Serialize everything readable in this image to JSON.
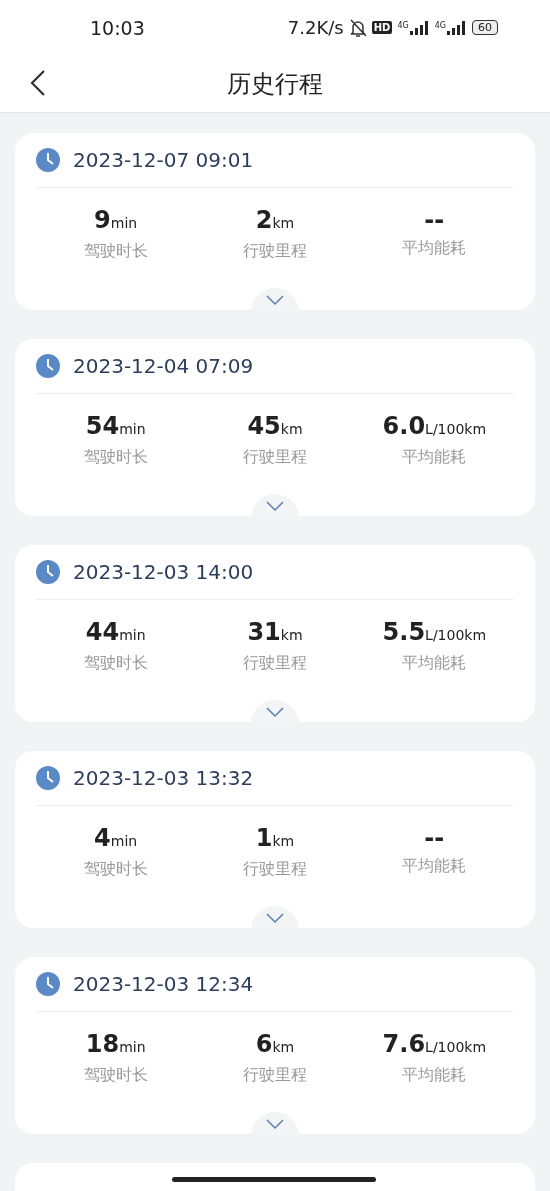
{
  "status_bar": {
    "time": "10:03",
    "net_speed": "7.2K/s",
    "hd": "HD",
    "signals": [
      "4G",
      "4G"
    ],
    "battery": "60"
  },
  "header": {
    "title": "历史行程"
  },
  "trips": [
    {
      "datetime": "2023-12-07 09:01",
      "stats": [
        {
          "value": "9",
          "unit": "min",
          "label": "驾驶时长"
        },
        {
          "value": "2",
          "unit": "km",
          "label": "行驶里程"
        },
        {
          "value": "--",
          "label": "平均能耗"
        }
      ]
    },
    {
      "datetime": "2023-12-04 07:09",
      "stats": [
        {
          "value": "54",
          "unit": "min",
          "label": "驾驶时长"
        },
        {
          "value": "45",
          "unit": "km",
          "label": "行驶里程"
        },
        {
          "value": "6.0",
          "unit": "L/100km",
          "label": "平均能耗"
        }
      ]
    },
    {
      "datetime": "2023-12-03 14:00",
      "stats": [
        {
          "value": "44",
          "unit": "min",
          "label": "驾驶时长"
        },
        {
          "value": "31",
          "unit": "km",
          "label": "行驶里程"
        },
        {
          "value": "5.5",
          "unit": "L/100km",
          "label": "平均能耗"
        }
      ]
    },
    {
      "datetime": "2023-12-03 13:32",
      "stats": [
        {
          "value": "4",
          "unit": "min",
          "label": "驾驶时长"
        },
        {
          "value": "1",
          "unit": "km",
          "label": "行驶里程"
        },
        {
          "value": "--",
          "label": "平均能耗"
        }
      ]
    },
    {
      "datetime": "2023-12-03 12:34",
      "stats": [
        {
          "value": "18",
          "unit": "min",
          "label": "驾驶时长"
        },
        {
          "value": "6",
          "unit": "km",
          "label": "行驶里程"
        },
        {
          "value": "7.6",
          "unit": "L/100km",
          "label": "平均能耗"
        }
      ]
    }
  ]
}
